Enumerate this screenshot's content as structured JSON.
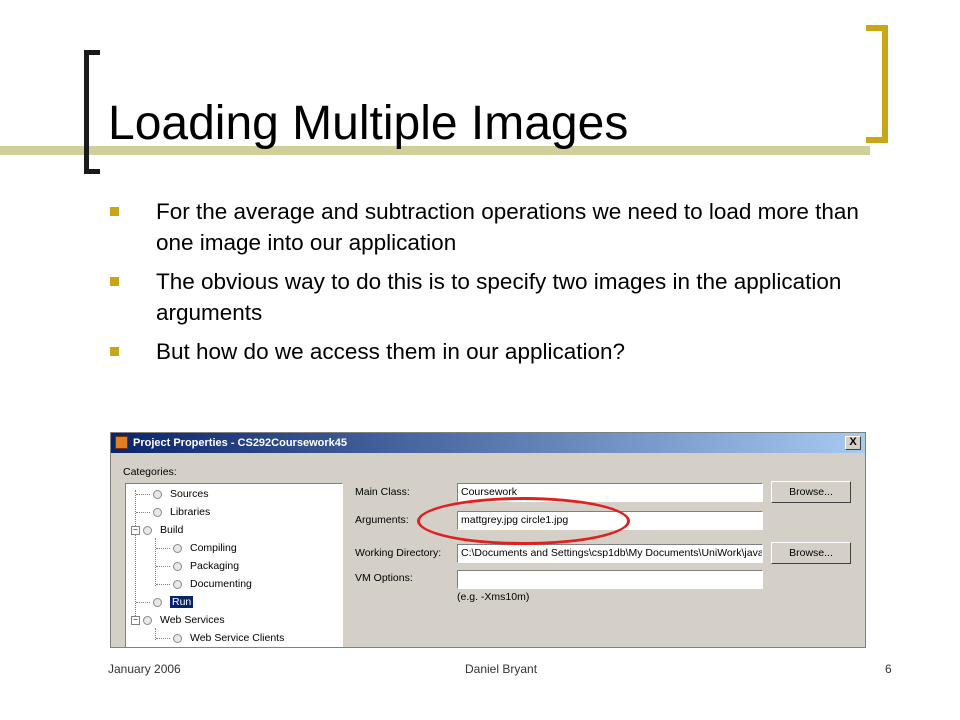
{
  "slide": {
    "title": "Loading Multiple Images",
    "bullets": [
      "For the average and subtraction operations we need to load more than one image into our application",
      "The obvious way to do this is to specify two images in the application arguments",
      "But how do we access them in our application?"
    ],
    "footer": {
      "date": "January 2006",
      "author": "Daniel Bryant",
      "page": "6"
    },
    "colors": {
      "accent": "#c8a616",
      "rule": "#cfcf9a",
      "highlight": "#e02020"
    }
  },
  "dialog": {
    "title": "Project Properties - CS292Coursework45",
    "close_label": "X",
    "categories_label": "Categories:",
    "tree": [
      "Sources",
      "Libraries",
      "Build",
      "Compiling",
      "Packaging",
      "Documenting",
      "Run",
      "Web Services",
      "Web Service Clients"
    ],
    "main_class_label": "Main Class:",
    "main_class_value": "Coursework",
    "arguments_label": "Arguments:",
    "arguments_value": "mattgrey.jpg circle1.jpg",
    "working_dir_label": "Working Directory:",
    "working_dir_value": "C:\\Documents and Settings\\csp1db\\My Documents\\UniWork\\java",
    "vm_options_label": "VM Options:",
    "vm_options_value": "",
    "vm_hint": "(e.g. -Xms10m)",
    "browse_label": "Browse...",
    "icons": [
      "app-icon",
      "close-icon",
      "expand-icon",
      "collapse-icon",
      "tree-node-icon"
    ]
  }
}
